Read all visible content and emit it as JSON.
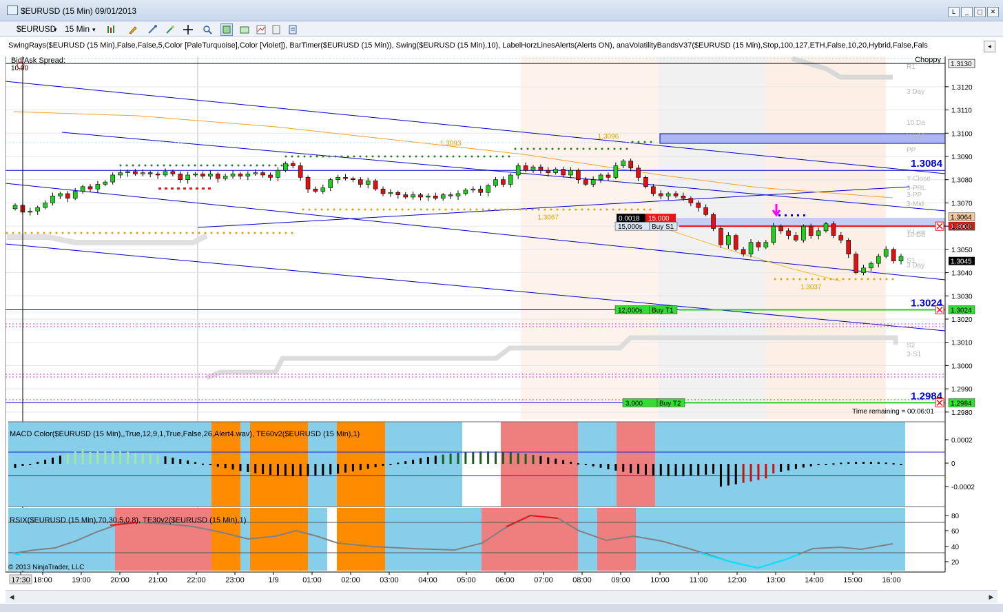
{
  "window": {
    "title": "$EURUSD (15 Min)  09/01/2013",
    "buttons": [
      "L",
      "_",
      "▢",
      "✕"
    ]
  },
  "toolbar": {
    "instrument": "$EURUSD",
    "interval": "15 Min"
  },
  "indicator_strip": "SwingRays($EURUSD (15 Min),False,False,5,Color [PaleTurquoise],Color [Violet]), BarTimer($EURUSD (15 Min)), Swing($EURUSD (15 Min),10), LabelHorzLinesAlerts(Alerts ON), anaVolatilityBandsV37($EURUSD (15 Min),Stop,100,127,ETH,False,10,20,Hybrid,False,Fals",
  "main_panel": {
    "bid_ask_label": "Bid/Ask Spread:",
    "spread_value": "10.00",
    "choppy_label": "Choppy",
    "time_remaining": "Time remaining = 00:06:01",
    "copyright": "© 2013 NinjaTrader, LLC",
    "last_price_label": "1.3045",
    "top_price_label": "1.3130"
  },
  "colors": {
    "up_candle": "#22cc22",
    "down_candle": "#dd1111",
    "channel": "#0000cc",
    "macd_bg": "#87ceeb",
    "salmon": "#ef7f7f",
    "orange": "#ff8c00"
  },
  "macd_panel": {
    "label": "MACD Color($EURUSD (15 Min),,True,12,9,1,True,False,26,Alert4.wav), TE60v2($EURUSD (15 Min),1)",
    "axis": [
      "0.0002",
      "0",
      "-0.0002"
    ]
  },
  "rsi_panel": {
    "label": "RSIX($EURUSD (15 Min),70,30,5,0.8), TE30v2($EURUSD (15 Min),1)",
    "axis": [
      "80",
      "60",
      "40",
      "20"
    ]
  },
  "chart_data": {
    "type": "candlestick",
    "instrument": "$EURUSD",
    "interval": "15 Min",
    "y_ticks": [
      "1.3120",
      "1.3110",
      "1.3100",
      "1.3090",
      "1.3080",
      "1.3070",
      "1.3060",
      "1.3050",
      "1.3040",
      "1.3030",
      "1.3020",
      "1.3010",
      "1.3000",
      "1.2990",
      "1.2980"
    ],
    "ylim": [
      1.2977,
      1.3133
    ],
    "x_ticks": [
      "17:30",
      "18:00",
      "19:00",
      "20:00",
      "21:00",
      "22:00",
      "23:00",
      "1/9",
      "01:00",
      "02:00",
      "03:00",
      "04:00",
      "05:00",
      "06:00",
      "07:00",
      "08:00",
      "09:00",
      "10:00",
      "11:00",
      "12:00",
      "13:00",
      "14:00",
      "15:00",
      "16:00"
    ],
    "candles": [
      [
        1.30675,
        1.3069
      ],
      [
        1.3069,
        1.3066
      ],
      [
        1.3066,
        1.30665
      ],
      [
        1.30665,
        1.3068
      ],
      [
        1.3068,
        1.307
      ],
      [
        1.307,
        1.3073
      ],
      [
        1.3073,
        1.3074
      ],
      [
        1.3074,
        1.3072
      ],
      [
        1.3072,
        1.3075
      ],
      [
        1.3075,
        1.3077
      ],
      [
        1.3077,
        1.3076
      ],
      [
        1.3076,
        1.3078
      ],
      [
        1.3078,
        1.3079
      ],
      [
        1.3079,
        1.3082
      ],
      [
        1.3082,
        1.3083
      ],
      [
        1.3083,
        1.30835
      ],
      [
        1.30835,
        1.30825
      ],
      [
        1.30825,
        1.3083
      ],
      [
        1.3083,
        1.30825
      ],
      [
        1.30825,
        1.3082
      ],
      [
        1.3082,
        1.30835
      ],
      [
        1.30835,
        1.30825
      ],
      [
        1.30825,
        1.308
      ],
      [
        1.308,
        1.3082
      ],
      [
        1.3082,
        1.30825
      ],
      [
        1.30825,
        1.30815
      ],
      [
        1.30815,
        1.30825
      ],
      [
        1.30825,
        1.30805
      ],
      [
        1.30805,
        1.30815
      ],
      [
        1.30815,
        1.30825
      ],
      [
        1.30825,
        1.30815
      ],
      [
        1.30815,
        1.30825
      ],
      [
        1.30825,
        1.3083
      ],
      [
        1.3083,
        1.3082
      ],
      [
        1.3082,
        1.3081
      ],
      [
        1.3081,
        1.3084
      ],
      [
        1.3084,
        1.3087
      ],
      [
        1.3087,
        1.3086
      ],
      [
        1.3086,
        1.3081
      ],
      [
        1.3081,
        1.3076
      ],
      [
        1.3076,
        1.3075
      ],
      [
        1.3075,
        1.30765
      ],
      [
        1.30765,
        1.308
      ],
      [
        1.308,
        1.3081
      ],
      [
        1.3081,
        1.30805
      ],
      [
        1.30805,
        1.308
      ],
      [
        1.308,
        1.3078
      ],
      [
        1.3078,
        1.30795
      ],
      [
        1.30795,
        1.3076
      ],
      [
        1.3076,
        1.3074
      ],
      [
        1.3074,
        1.30745
      ],
      [
        1.30745,
        1.30735
      ],
      [
        1.30735,
        1.30725
      ],
      [
        1.30725,
        1.30735
      ],
      [
        1.30735,
        1.30725
      ],
      [
        1.30725,
        1.3073
      ],
      [
        1.3073,
        1.3072
      ],
      [
        1.3072,
        1.30735
      ],
      [
        1.30735,
        1.3073
      ],
      [
        1.3073,
        1.3074
      ],
      [
        1.3074,
        1.30755
      ],
      [
        1.30755,
        1.3076
      ],
      [
        1.3076,
        1.30745
      ],
      [
        1.30745,
        1.30775
      ],
      [
        1.30775,
        1.308
      ],
      [
        1.308,
        1.3078
      ],
      [
        1.3078,
        1.3082
      ],
      [
        1.3082,
        1.3086
      ],
      [
        1.3086,
        1.3084
      ],
      [
        1.3084,
        1.30855
      ],
      [
        1.30855,
        1.3084
      ],
      [
        1.3084,
        1.3083
      ],
      [
        1.3083,
        1.30845
      ],
      [
        1.30845,
        1.3082
      ],
      [
        1.3082,
        1.3084
      ],
      [
        1.3084,
        1.308
      ],
      [
        1.308,
        1.3078
      ],
      [
        1.3078,
        1.308
      ],
      [
        1.308,
        1.3082
      ],
      [
        1.3082,
        1.3081
      ],
      [
        1.3081,
        1.3086
      ],
      [
        1.3086,
        1.3088
      ],
      [
        1.3088,
        1.3085
      ],
      [
        1.3085,
        1.3081
      ],
      [
        1.3081,
        1.3077
      ],
      [
        1.3077,
        1.3074
      ],
      [
        1.3074,
        1.3073
      ],
      [
        1.3073,
        1.3074
      ],
      [
        1.3074,
        1.3073
      ],
      [
        1.3073,
        1.3072
      ],
      [
        1.3072,
        1.307
      ],
      [
        1.307,
        1.3068
      ],
      [
        1.3068,
        1.3065
      ],
      [
        1.3065,
        1.3059
      ],
      [
        1.3059,
        1.3052
      ],
      [
        1.3052,
        1.3056
      ],
      [
        1.3056,
        1.305
      ],
      [
        1.305,
        1.3048
      ],
      [
        1.3048,
        1.3053
      ],
      [
        1.3053,
        1.3051
      ],
      [
        1.3051,
        1.3053
      ],
      [
        1.3053,
        1.306
      ],
      [
        1.306,
        1.3058
      ],
      [
        1.3058,
        1.3056
      ],
      [
        1.3056,
        1.3054
      ],
      [
        1.3054,
        1.306
      ],
      [
        1.306,
        1.3056
      ],
      [
        1.3056,
        1.3058
      ],
      [
        1.3058,
        1.3061
      ],
      [
        1.3061,
        1.3056
      ],
      [
        1.3056,
        1.3054
      ],
      [
        1.3054,
        1.3048
      ],
      [
        1.3048,
        1.304
      ],
      [
        1.304,
        1.3042
      ],
      [
        1.3042,
        1.3044
      ],
      [
        1.3044,
        1.3047
      ],
      [
        1.3047,
        1.305
      ],
      [
        1.305,
        1.3045
      ],
      [
        1.3045,
        1.3047
      ]
    ],
    "horizontal_levels": [
      {
        "price": 1.3084,
        "label": "1.3084",
        "color": "#0000cc"
      },
      {
        "price": 1.3024,
        "label": "1.3024",
        "color": "#0000cc"
      },
      {
        "price": 1.2984,
        "label": "1.2984",
        "color": "#0000cc"
      }
    ],
    "price_labels": [
      {
        "price": 1.3064,
        "label": "1.3064",
        "bg": "#f0c8a0"
      },
      {
        "price": 1.306,
        "label": "1.3060",
        "bg": "#ee1111"
      },
      {
        "price": 1.3024,
        "label": "1.3024",
        "bg": "#33dd33"
      },
      {
        "price": 1.2984,
        "label": "1.2984",
        "bg": "#33dd33"
      }
    ],
    "swing_labels": [
      {
        "text": "1.3093",
        "bar": 58
      },
      {
        "text": "1.3096",
        "bar": 79
      },
      {
        "text": "1.3067",
        "bar": 71
      },
      {
        "text": "1.3037",
        "bar": 106
      }
    ],
    "pivot_labels": [
      "R1",
      "3 Day",
      "10 Da",
      "Y-Mid",
      "PP",
      "Y-Close",
      "3-PRL",
      "3-PP",
      "3-Mid",
      "10 Da",
      "Y-Low",
      "S1",
      "3 Day",
      "S2",
      "3-S1"
    ],
    "orders": [
      {
        "qty": "15,000s",
        "type": "Buy S1",
        "pnl": "0.0018",
        "pnl_qty": "15,000"
      },
      {
        "qty": "12,000s",
        "type": "Buy T1"
      },
      {
        "qty": "3,000",
        "type": "Buy T2"
      }
    ]
  }
}
